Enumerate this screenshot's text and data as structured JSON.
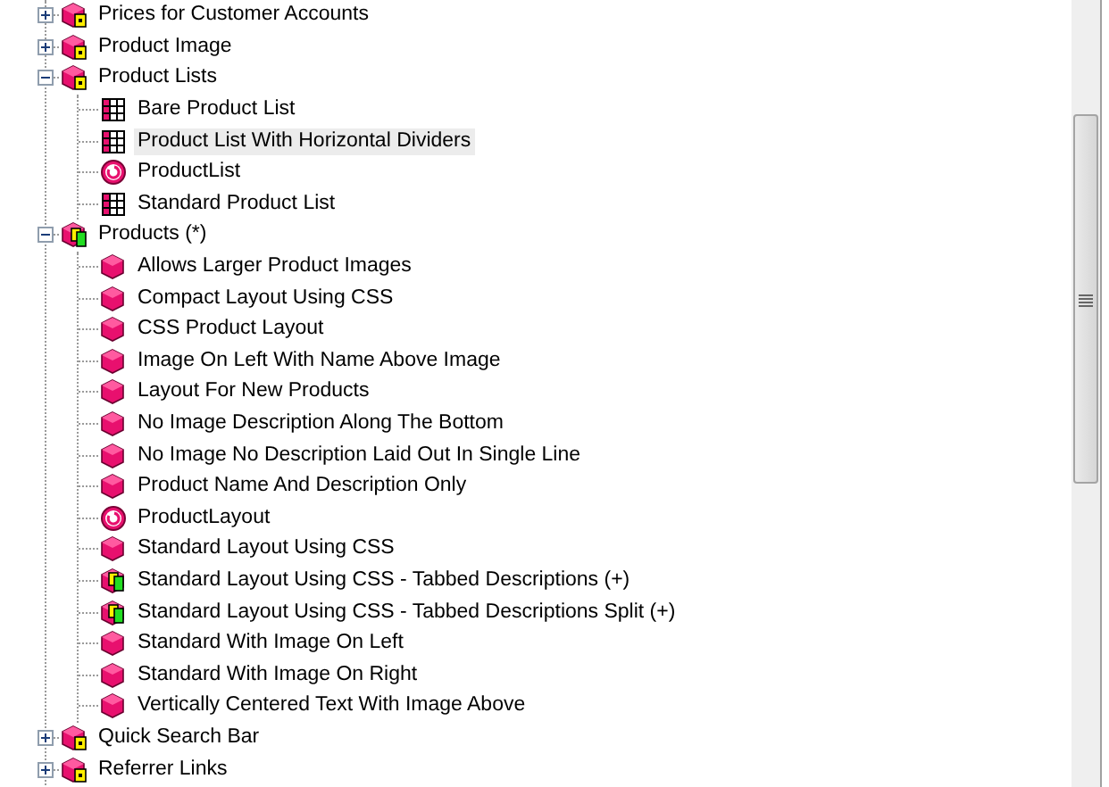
{
  "tree": [
    {
      "label": "Prices for Customer Accounts",
      "kind": "folder",
      "expanded": false,
      "selected": false
    },
    {
      "label": "Product Image",
      "kind": "folder",
      "expanded": false,
      "selected": false
    },
    {
      "label": "Product Lists",
      "kind": "folder",
      "expanded": true,
      "selected": false,
      "children": [
        {
          "label": "Bare Product List",
          "kind": "grid",
          "selected": false
        },
        {
          "label": "Product List With Horizontal Dividers",
          "kind": "grid",
          "selected": true
        },
        {
          "label": "ProductList",
          "kind": "circle",
          "selected": false
        },
        {
          "label": "Standard Product List",
          "kind": "grid",
          "selected": false
        }
      ]
    },
    {
      "label": "Products (*)",
      "kind": "folder-mixed",
      "expanded": true,
      "selected": false,
      "children": [
        {
          "label": "Allows Larger Product Images",
          "kind": "cube",
          "selected": false
        },
        {
          "label": "Compact Layout Using CSS",
          "kind": "cube",
          "selected": false
        },
        {
          "label": "CSS Product Layout",
          "kind": "cube",
          "selected": false
        },
        {
          "label": "Image On Left With Name Above Image",
          "kind": "cube",
          "selected": false
        },
        {
          "label": "Layout For New Products",
          "kind": "cube",
          "selected": false
        },
        {
          "label": "No Image Description Along The Bottom",
          "kind": "cube",
          "selected": false
        },
        {
          "label": "No Image No Description Laid Out In Single Line",
          "kind": "cube",
          "selected": false
        },
        {
          "label": "Product Name And Description Only",
          "kind": "cube",
          "selected": false
        },
        {
          "label": "ProductLayout",
          "kind": "circle",
          "selected": false
        },
        {
          "label": "Standard Layout Using CSS",
          "kind": "cube",
          "selected": false
        },
        {
          "label": "Standard Layout Using CSS - Tabbed Descriptions (+)",
          "kind": "cube-mixed",
          "selected": false
        },
        {
          "label": "Standard Layout Using CSS - Tabbed Descriptions Split (+)",
          "kind": "cube-mixed",
          "selected": false
        },
        {
          "label": "Standard With Image On Left",
          "kind": "cube",
          "selected": false
        },
        {
          "label": "Standard With Image On Right",
          "kind": "cube",
          "selected": false
        },
        {
          "label": "Vertically Centered Text With Image Above",
          "kind": "cube",
          "selected": false
        }
      ]
    },
    {
      "label": "Quick Search Bar",
      "kind": "folder",
      "expanded": false,
      "selected": false
    },
    {
      "label": "Referrer Links",
      "kind": "folder",
      "expanded": false,
      "selected": false
    }
  ]
}
